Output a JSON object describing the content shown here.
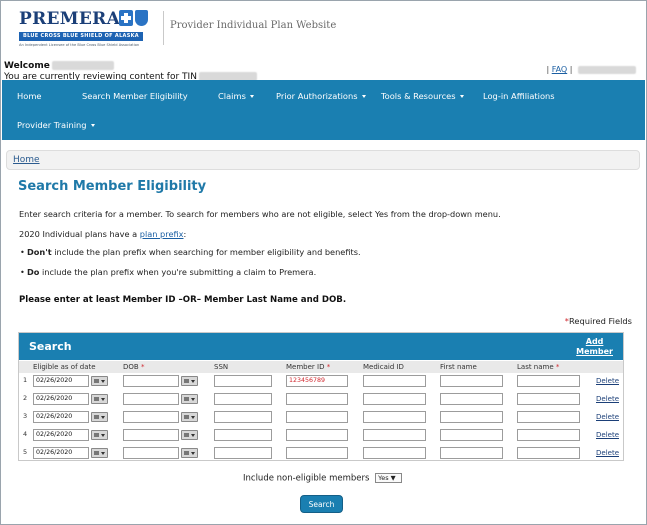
{
  "header": {
    "logo_name": "PREMERA",
    "logo_band": "BLUE CROSS BLUE SHIELD OF ALASKA",
    "logo_tagline": "An Independent Licensee of the Blue Cross Blue Shield Association",
    "site_title": "Provider Individual Plan Website"
  },
  "welcome": {
    "greeting": "Welcome",
    "tin_text": "You are currently reviewing content for TIN"
  },
  "toplinks": {
    "sep1": "|",
    "faq": "FAQ",
    "sep2": "|"
  },
  "nav": {
    "items": [
      {
        "label": "Home",
        "dropdown": false
      },
      {
        "label": "Search Member Eligibility",
        "dropdown": false
      },
      {
        "label": "Claims",
        "dropdown": true
      },
      {
        "label": "Prior Authorizations",
        "dropdown": true
      },
      {
        "label": "Tools & Resources",
        "dropdown": true
      },
      {
        "label": "Log-in Affiliations",
        "dropdown": false
      },
      {
        "label": "Provider Training",
        "dropdown": true
      }
    ]
  },
  "breadcrumb": {
    "home": "Home"
  },
  "main": {
    "title": "Search Member Eligibility",
    "intro": "Enter search criteria for a member. To search for members who are not eligible, select Yes from the drop-down menu.",
    "plan_line_pre": "2020 Individual plans have a",
    "plan_link": "plan prefix",
    "plan_line_post": ":",
    "bullet1_bold": "Don't",
    "bullet1_rest": "include the plan prefix when searching for member eligibility and benefits.",
    "bullet2_bold": "Do",
    "bullet2_rest": "include the plan prefix when you're submitting a claim to Premera.",
    "requirement": "Please enter at least Member ID –OR– Member Last Name and DOB.",
    "required_star": "*",
    "required_label": "Required Fields"
  },
  "search": {
    "title": "Search",
    "add_member_line1": "Add",
    "add_member_line2": "Member",
    "columns": {
      "eligible": "Eligible as of date",
      "dob": "DOB",
      "ssn": "SSN",
      "member_id": "Member ID",
      "medicaid": "Medicaid ID",
      "first": "First name",
      "last": "Last name",
      "star": "*"
    },
    "rows": [
      {
        "num": "1",
        "date": "02/26/2020",
        "member_id": "123456789",
        "delete": "Delete"
      },
      {
        "num": "2",
        "date": "02/26/2020",
        "member_id": "",
        "delete": "Delete"
      },
      {
        "num": "3",
        "date": "02/26/2020",
        "member_id": "",
        "delete": "Delete"
      },
      {
        "num": "4",
        "date": "02/26/2020",
        "member_id": "",
        "delete": "Delete"
      },
      {
        "num": "5",
        "date": "02/26/2020",
        "member_id": "",
        "delete": "Delete"
      }
    ],
    "include_label": "Include non-eligible members",
    "include_value": "Yes ▼",
    "button": "Search"
  },
  "colors": {
    "brand_blue": "#1a7fb1",
    "title_blue": "#1f79a8",
    "required_red": "#d0282e"
  }
}
